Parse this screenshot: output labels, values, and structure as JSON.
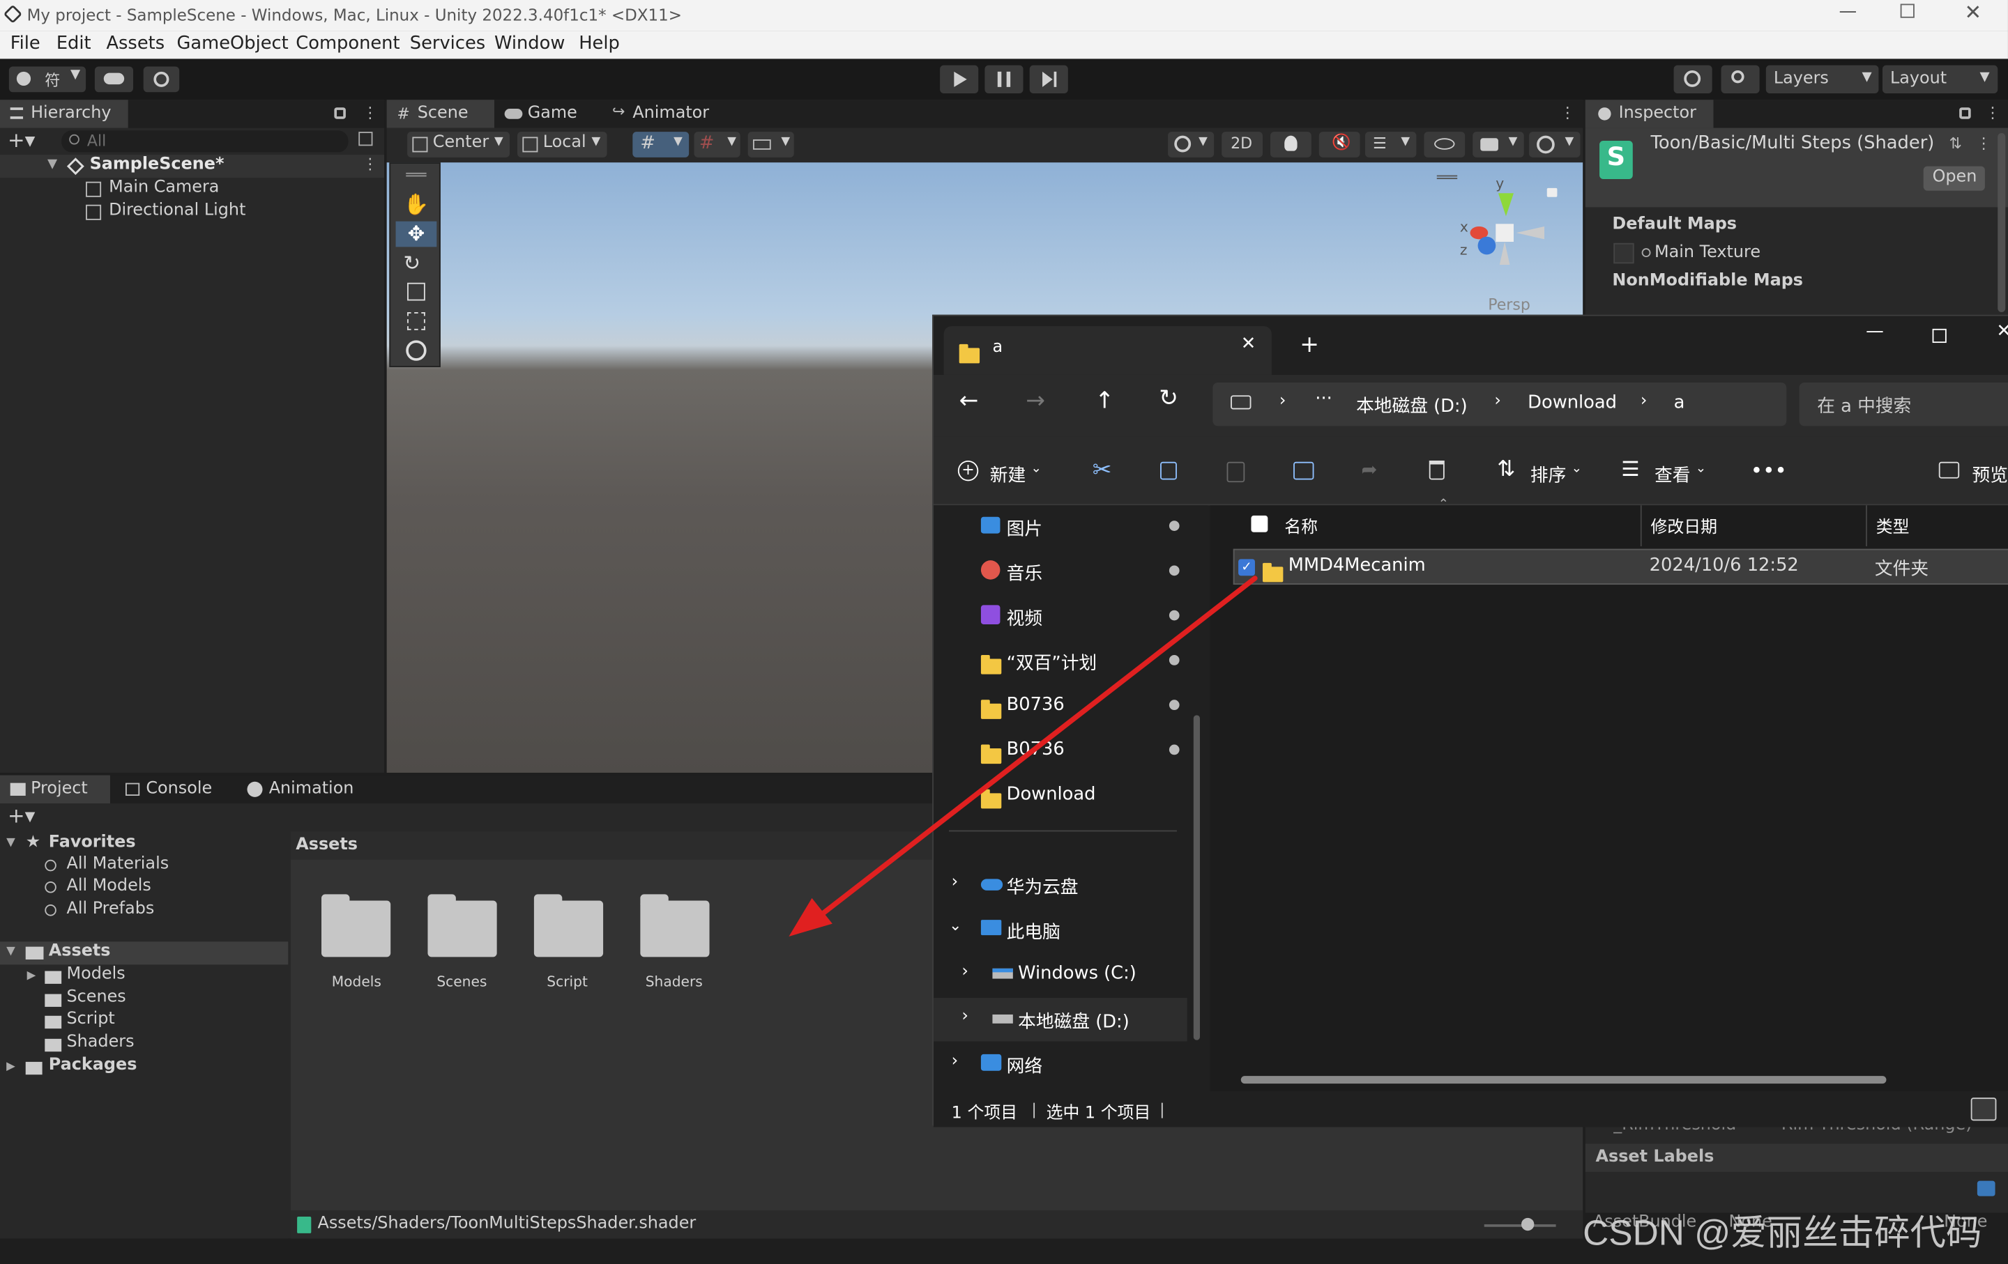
{
  "window": {
    "title": "My project - SampleScene - Windows, Mac, Linux - Unity 2022.3.40f1c1* <DX11>"
  },
  "menu": [
    "File",
    "Edit",
    "Assets",
    "GameObject",
    "Component",
    "Services",
    "Window",
    "Help"
  ],
  "toolbar": {
    "account_label": "符",
    "layers_label": "Layers",
    "layout_label": "Layout"
  },
  "hierarchy": {
    "tab": "Hierarchy",
    "search_placeholder": "All",
    "scene": "SampleScene*",
    "items": [
      "Main Camera",
      "Directional Light"
    ]
  },
  "scene_view": {
    "tabs": [
      "Scene",
      "Game",
      "Animator"
    ],
    "pivot": "Center",
    "space": "Local",
    "mode_2d": "2D",
    "gizmo_y": "y",
    "gizmo_x": "x",
    "gizmo_z": "z",
    "persp_label": "Persp"
  },
  "inspector": {
    "tab": "Inspector",
    "shader_title": "Toon/Basic/Multi Steps (Shader)",
    "open_button": "Open",
    "default_maps": "Default Maps",
    "main_texture": "Main Texture",
    "nonmodifiable": "NonModifiable Maps",
    "rim_threshold": "_RimThreshold",
    "rim_threshold_value": "Rim Threshold (Range)",
    "asset_labels": "Asset Labels",
    "assetbundle": "AssetBundle",
    "assetbundle_value": "None",
    "assetbundle_value2": "None"
  },
  "project": {
    "tabs": [
      "Project",
      "Console",
      "Animation"
    ],
    "favorites": "Favorites",
    "favorite_items": [
      "All Materials",
      "All Models",
      "All Prefabs"
    ],
    "assets_root": "Assets",
    "asset_folders": [
      "Models",
      "Scenes",
      "Script",
      "Shaders"
    ],
    "packages": "Packages",
    "assets_header": "Assets",
    "grid_folders": [
      "Models",
      "Scenes",
      "Script",
      "Shaders"
    ],
    "status_path": "Assets/Shaders/ToonMultiStepsShader.shader"
  },
  "explorer": {
    "tab_title": "a",
    "breadcrumb": [
      "本地磁盘 (D:)",
      "Download",
      "a"
    ],
    "breadcrumb_more": "···",
    "search_placeholder": "在 a 中搜索",
    "commands": {
      "new": "新建",
      "sort": "排序",
      "view": "查看",
      "more": "•••",
      "preview": "预览"
    },
    "quick_access": [
      "图片",
      "音乐",
      "视频",
      "“双百”计划",
      "B0736",
      "B0736",
      "Download"
    ],
    "tree": [
      "华为云盘",
      "此电脑",
      "Windows (C:)",
      "本地磁盘 (D:)",
      "网络"
    ],
    "columns": [
      "名称",
      "修改日期",
      "类型"
    ],
    "files": [
      {
        "name": "MMD4Mecanim",
        "date": "2024/10/6 12:52",
        "type": "文件夹"
      }
    ],
    "status_count": "1 个项目",
    "status_selected": "选中 1 个项目"
  },
  "watermark": "CSDN @爱丽丝击碎代码",
  "colors": {
    "unity_accent": "#3a79bb",
    "explorer_selected": "#3d3d3d",
    "arrow": "#e02020",
    "folder": "#f3c743"
  }
}
